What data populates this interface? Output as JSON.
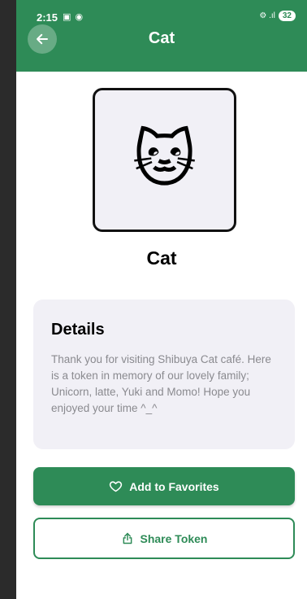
{
  "status_bar": {
    "time": "2:15",
    "left_icons": "▣ ◉",
    "right_icons": "⚙ .ıl",
    "battery": "32"
  },
  "header": {
    "title": "Cat",
    "back_icon": "arrow-left-icon"
  },
  "token": {
    "emoji": "🐱",
    "name": "Cat"
  },
  "details": {
    "heading": "Details",
    "text": "Thank you for visiting Shibuya Cat café. Here is a token in memory of our lovely family; Unicorn, latte, Yuki and Momo! Hope you enjoyed your time ^_^"
  },
  "actions": {
    "favorite_label": "Add to Favorites",
    "favorite_icon": "heart-icon",
    "share_label": "Share Token",
    "share_icon": "share-icon"
  },
  "colors": {
    "primary": "#2e8b57",
    "card_bg": "#f1f0f6",
    "muted_text": "#8a8a8f"
  }
}
